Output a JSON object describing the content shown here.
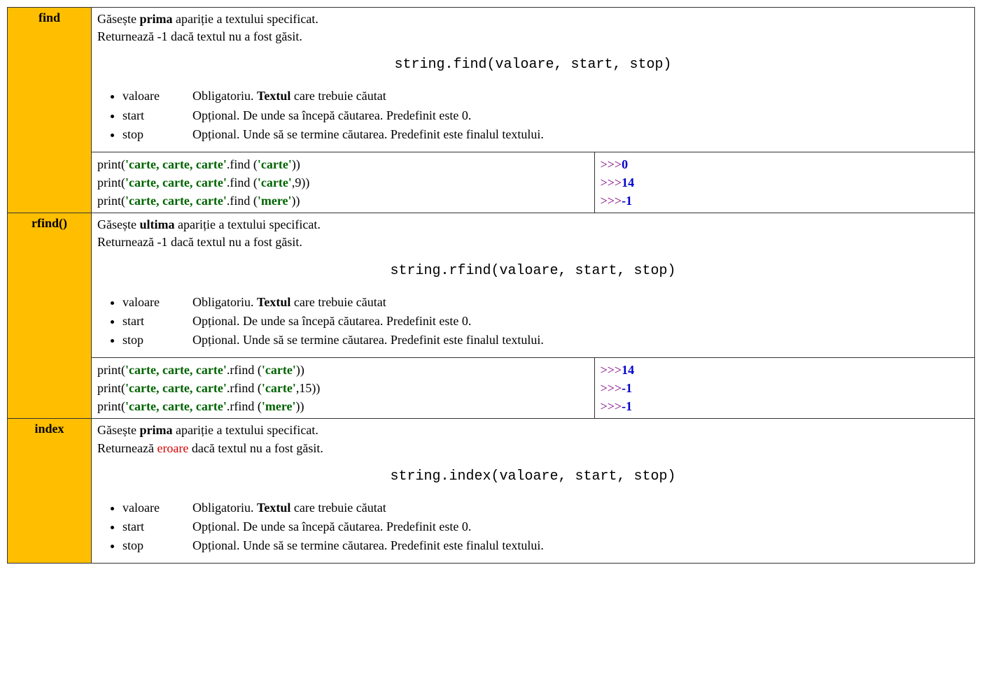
{
  "rows": [
    {
      "name": "find",
      "desc": {
        "line1_pre": "Găsește ",
        "line1_bold": "prima",
        "line1_post": " apariție a textului specificat.",
        "line2": "Returnează -1 dacă textul nu a fost găsit.",
        "line2_err_word": "",
        "line2_err_post": ""
      },
      "signature": "string.find(valoare, start, stop)",
      "params": [
        {
          "name": "valoare",
          "pre": "Obligatoriu. ",
          "bold": "Textul",
          "post": " care trebuie căutat"
        },
        {
          "name": "start",
          "pre": "Opțional. De unde sa începă căutarea. Predefinit este 0.",
          "bold": "",
          "post": ""
        },
        {
          "name": "stop",
          "pre": "Opțional. Unde să se termine căutarea. Predefinit este finalul textului.",
          "bold": "",
          "post": ""
        }
      ],
      "example": {
        "l1": {
          "pre": "print(",
          "s": "'carte, carte, carte'",
          "mid": ".find (",
          "a": "'carte'",
          "tail": "))"
        },
        "l2": {
          "pre": "print(",
          "s": "'carte, carte, carte'",
          "mid": ".find (",
          "a": "'carte'",
          "tail": ",9))"
        },
        "l3": {
          "pre": "print(",
          "s": "'carte, carte, carte'",
          "mid": ".find (",
          "a": "'mere'",
          "tail": "))"
        },
        "o1": "0",
        "o2": "14",
        "o3": "-1"
      }
    },
    {
      "name": "rfind()",
      "desc": {
        "line1_pre": "Găsește ",
        "line1_bold": "ultima",
        "line1_post": " apariție a textului specificat.",
        "line2": "Returnează -1 dacă textul nu a fost găsit.",
        "line2_err_word": "",
        "line2_err_post": ""
      },
      "signature": "string.rfind(valoare, start, stop)",
      "params": [
        {
          "name": "valoare",
          "pre": "Obligatoriu. ",
          "bold": "Textul",
          "post": " care trebuie căutat"
        },
        {
          "name": "start",
          "pre": "Opțional. De unde sa începă căutarea. Predefinit este 0.",
          "bold": "",
          "post": ""
        },
        {
          "name": "stop",
          "pre": "Opțional. Unde să se termine căutarea. Predefinit este finalul textului.",
          "bold": "",
          "post": ""
        }
      ],
      "example": {
        "l1": {
          "pre": "print(",
          "s": "'carte, carte, carte'",
          "mid": ".rfind (",
          "a": "'carte'",
          "tail": "))"
        },
        "l2": {
          "pre": "print(",
          "s": "'carte, carte, carte'",
          "mid": ".rfind (",
          "a": "'carte'",
          "tail": ",15))"
        },
        "l3": {
          "pre": "print(",
          "s": "'carte, carte, carte'",
          "mid": ".rfind (",
          "a": "'mere'",
          "tail": "))"
        },
        "o1": "14",
        "o2": "-1",
        "o3": "-1"
      }
    },
    {
      "name": "index",
      "desc": {
        "line1_pre": "Găsește ",
        "line1_bold": "prima",
        "line1_post": " apariție a textului specificat.",
        "line2": "Returnează ",
        "line2_err_word": "eroare",
        "line2_err_post": " dacă textul nu a fost găsit."
      },
      "signature": "string.index(valoare, start, stop)",
      "params": [
        {
          "name": "valoare",
          "pre": "Obligatoriu. ",
          "bold": "Textul",
          "post": " care trebuie căutat"
        },
        {
          "name": "start",
          "pre": "Opțional. De unde sa începă căutarea. Predefinit este 0.",
          "bold": "",
          "post": ""
        },
        {
          "name": "stop",
          "pre": "Opțional. Unde să se termine căutarea. Predefinit este finalul textului.",
          "bold": "",
          "post": ""
        }
      ],
      "example": null
    }
  ]
}
